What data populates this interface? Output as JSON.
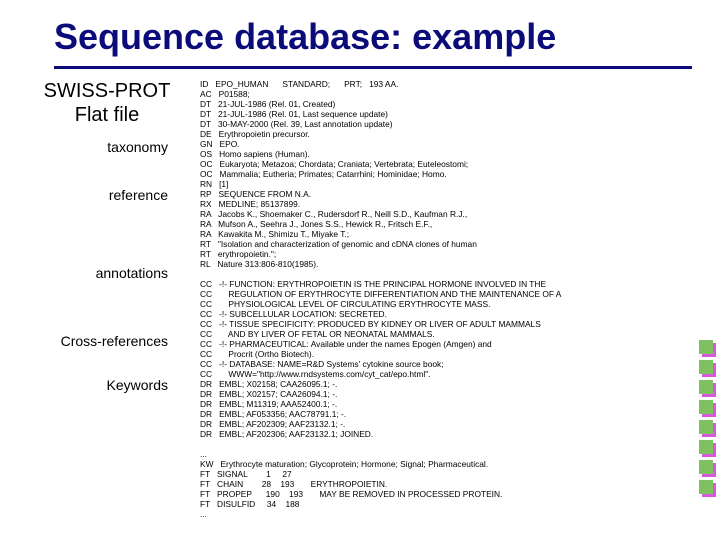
{
  "title": "Sequence database: example",
  "labels": {
    "big1": "SWISS-PROT",
    "big2": "Flat file",
    "taxonomy": "taxonomy",
    "reference": "reference",
    "annotations": "annotations",
    "crossrefs": "Cross-references",
    "keywords": "Keywords"
  },
  "record": {
    "block1": "ID   EPO_HUMAN      STANDARD;      PRT;   193 AA.\nAC   P01588;\nDT   21-JUL-1986 (Rel. 01, Created)\nDT   21-JUL-1986 (Rel. 01, Last sequence update)\nDT   30-MAY-2000 (Rel. 39, Last annotation update)\nDE   Erythropoietin precursor.\nGN   EPO.\nOS   Homo sapiens (Human).\nOC   Eukaryota; Metazoa; Chordata; Craniata; Vertebrata; Euteleostomi;\nOC   Mammalia; Eutheria; Primates; Catarrhini; Hominidae; Homo.\nRN   [1]\nRP   SEQUENCE FROM N.A.\nRX   MEDLINE; 85137899.\nRA   Jacobs K., Shoemaker C., Rudersdorf R., Neill S.D., Kaufman R.J.,\nRA   Mufson A., Seehra J., Jones S.S., Hewick R., Fritsch E.F.,\nRA   Kawakita M., Shimizu T., Miyake T.;\nRT   \"Isolation and characterization of genomic and cDNA clones of human\nRT   erythropoietin.\";\nRL   Nature 313:806-810(1985).",
    "block2": "CC   -!- FUNCTION: ERYTHROPOIETIN IS THE PRINCIPAL HORMONE INVOLVED IN THE\nCC       REGULATION OF ERYTHROCYTE DIFFERENTIATION AND THE MAINTENANCE OF A\nCC       PHYSIOLOGICAL LEVEL OF CIRCULATING ERYTHROCYTE MASS.\nCC   -!- SUBCELLULAR LOCATION: SECRETED.\nCC   -!- TISSUE SPECIFICITY: PRODUCED BY KIDNEY OR LIVER OF ADULT MAMMALS\nCC       AND BY LIVER OF FETAL OR NEONATAL MAMMALS.\nCC   -!- PHARMACEUTICAL: Available under the names Epogen (Amgen) and\nCC       Procrit (Ortho Biotech).\nCC   -!- DATABASE: NAME=R&D Systems' cytokine source book;\nCC       WWW=\"http://www.rndsystems.com/cyt_cat/epo.html\".\nDR   EMBL; X02158; CAA26095.1; -.\nDR   EMBL; X02157; CAA26094.1; -.\nDR   EMBL; M11319; AAA52400.1; -.\nDR   EMBL; AF053356; AAC78791.1; -.\nDR   EMBL; AF202309; AAF23132.1; -.\nDR   EMBL; AF202306; AAF23132.1; JOINED.",
    "block3": "...\nKW   Erythrocyte maturation; Glycoprotein; Hormone; Signal; Pharmaceutical.\nFT   SIGNAL        1     27\nFT   CHAIN        28    193       ERYTHROPOIETIN.\nFT   PROPEP      190    193       MAY BE REMOVED IN PROCESSED PROTEIN.\nFT   DISULFID     34    188\n..."
  }
}
